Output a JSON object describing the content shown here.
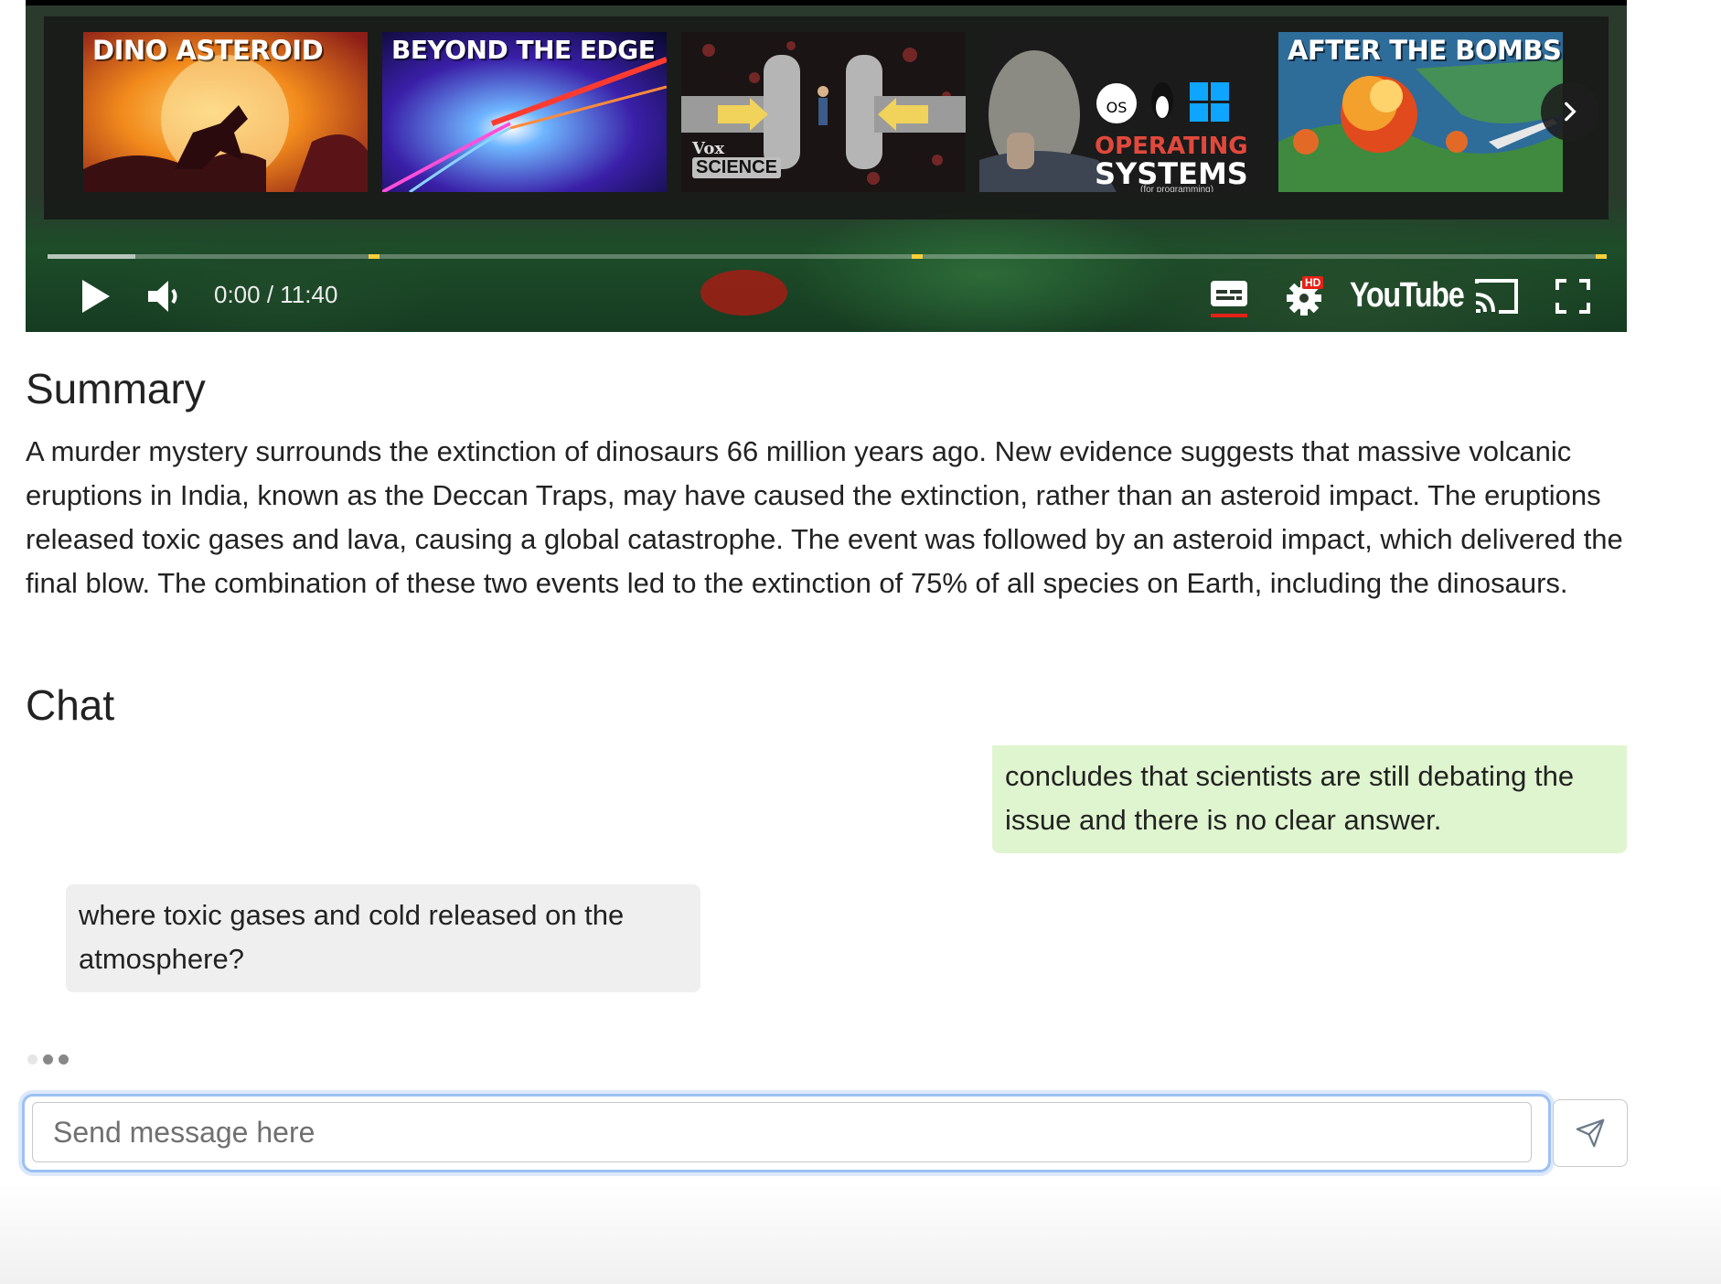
{
  "player": {
    "endscreen": [
      {
        "title": "DINO ASTEROID"
      },
      {
        "title": "BEYOND THE EDGE"
      },
      {
        "title": "",
        "brand": "Vox",
        "tag": "SCIENCE"
      },
      {
        "title": "OPERATING",
        "title2": "SYSTEMS",
        "subtitle": "(for programming)",
        "badge": "mac OS"
      },
      {
        "title": "AFTER THE BOMBS"
      }
    ],
    "time": "0:00 / 11:40",
    "logo": "YouTube",
    "hd_badge": "HD",
    "icons": {
      "play": "play-icon",
      "volume": "volume-icon",
      "captions": "captions-icon",
      "settings": "settings-gear-icon",
      "cast": "cast-icon",
      "fullscreen": "fullscreen-icon",
      "next": "chevron-right-icon"
    },
    "colors": {
      "chapter_marker": "#f6cf3a",
      "captions_active": "#e62117"
    }
  },
  "summary": {
    "heading": "Summary",
    "text": "A murder mystery surrounds the extinction of dinosaurs 66 million years ago. New evidence suggests that massive volcanic eruptions in India, known as the Deccan Traps, may have caused the extinction, rather than an asteroid impact. The eruptions released toxic gases and lava, causing a global catastrophe. The event was followed by an asteroid impact, which delivered the final blow. The combination of these two events led to the extinction of 75% of all species on Earth, including the dinosaurs."
  },
  "chat": {
    "heading": "Chat",
    "messages": [
      {
        "role": "assistant",
        "text": "concludes that scientists are still debating the issue and there is no clear answer."
      },
      {
        "role": "user",
        "text": "where toxic gases and cold released on the atmosphere?"
      }
    ],
    "input_placeholder": "Send message here",
    "send_icon": "send-paper-plane-icon",
    "colors": {
      "assistant_bubble": "#dff5cf",
      "user_bubble": "#efefef",
      "input_focus": "#9cc0f4"
    }
  }
}
